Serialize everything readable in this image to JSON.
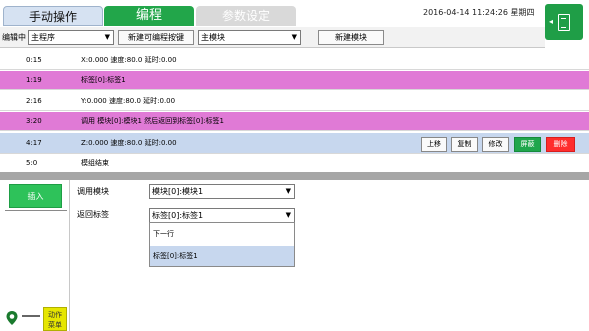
{
  "tabs": {
    "manual": "手动操作",
    "program": "编程",
    "params": "参数设定"
  },
  "status": {
    "datetime": "2016-04-14  11:24:26  星期四"
  },
  "toolbar": {
    "mode_label": "编辑中",
    "program_select": "主程序",
    "new_key_button": "新建可编程按键",
    "module_select": "主模块",
    "new_module_button": "新建模块"
  },
  "rows": [
    {
      "num": "0:15",
      "text": "X:0.000 速度:80.0 延时:0.00"
    },
    {
      "num": "1:19",
      "text": "标签[0]:标签1"
    },
    {
      "num": "2:16",
      "text": "Y:0.000 速度:80.0 延时:0.00"
    },
    {
      "num": "3:20",
      "text": "调用 模块[0]:模块1 然后返回到标签[0]:标签1"
    },
    {
      "num": "4:17",
      "text": "Z:0.000 速度:80.0 延时:0.00"
    },
    {
      "num": "5:0",
      "text": "模组结束"
    }
  ],
  "row_actions": {
    "up": "上移",
    "copy": "复制",
    "modify": "修改",
    "shield": "屏蔽",
    "delete": "删除"
  },
  "editor": {
    "insert_button": "插入",
    "call_module_label": "调用模块",
    "call_module_value": "模块[0]:模块1",
    "return_label_label": "返回标签",
    "return_label_value": "标签[0]:标签1",
    "dropdown_options": [
      "下一行",
      "标签[0]:标签1"
    ],
    "action_menu_line1": "动作",
    "action_menu_line2": "菜单"
  },
  "colors": {
    "accent_green": "#22a64a",
    "row_pink": "#e07ad6",
    "row_selected": "#c7d7ee",
    "delete_red": "#ff2d2d"
  },
  "icons": {
    "corner": "display-icon",
    "pin": "location-pin-icon"
  }
}
